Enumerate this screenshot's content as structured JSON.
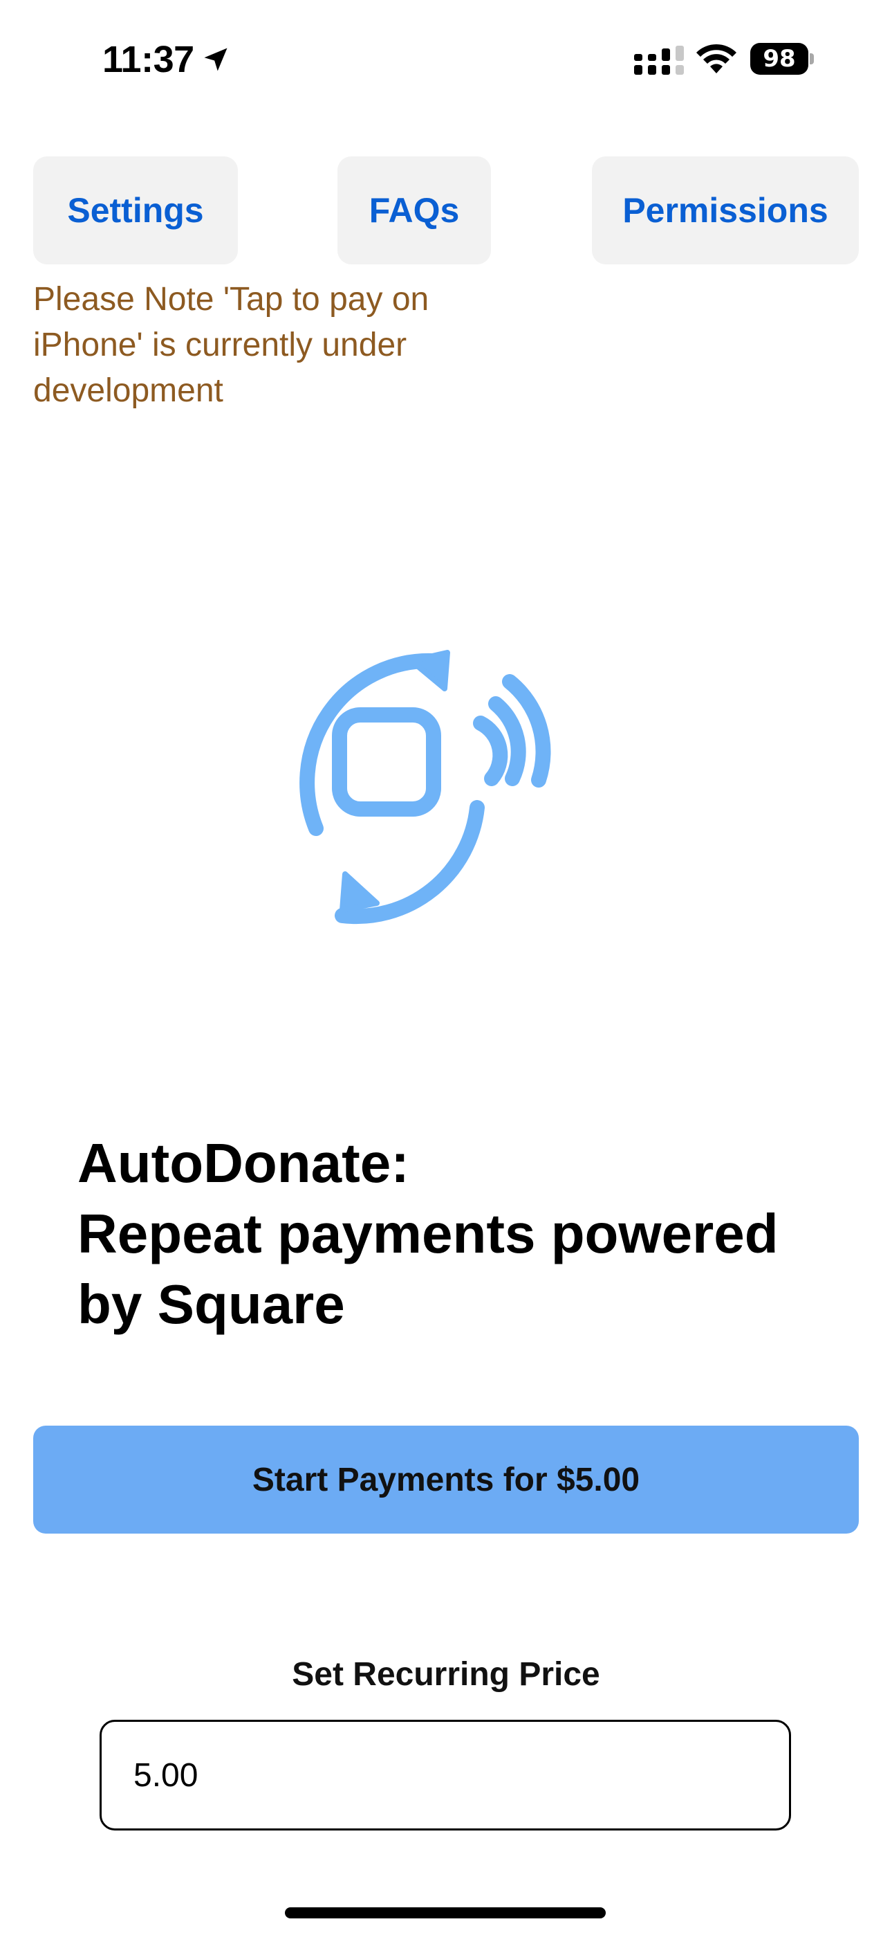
{
  "status_bar": {
    "time": "11:37",
    "battery": "98",
    "icons": [
      "location-arrow-icon",
      "cellular-signal-icon",
      "wifi-icon",
      "battery-icon"
    ]
  },
  "top_nav": {
    "settings_label": "Settings",
    "faqs_label": "FAQs",
    "permissions_label": "Permissions"
  },
  "note": {
    "text": "Please Note 'Tap to pay on iPhone' is currently under development"
  },
  "hero": {
    "icon": "contactless-repeat-icon",
    "color": "#6fb3f7"
  },
  "headline": {
    "line1": "AutoDonate:",
    "line2": "Repeat payments powered by Square"
  },
  "start_button": {
    "label": "Start Payments for $5.00",
    "color": "#6cabf4"
  },
  "price": {
    "label": "Set Recurring Price",
    "value": "5.00"
  },
  "colors": {
    "link_blue": "#0a5fd3",
    "note_brown": "#8d5a21",
    "button_gray": "#f2f2f2"
  }
}
